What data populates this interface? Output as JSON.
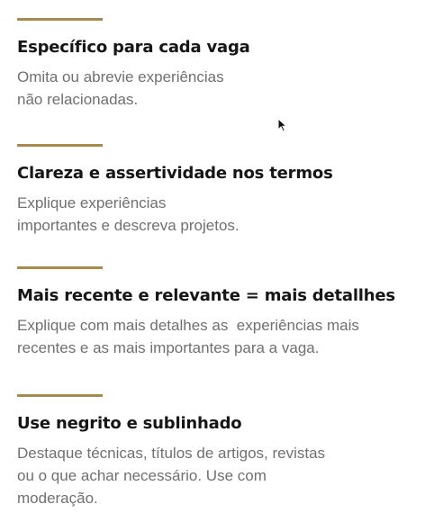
{
  "sections": [
    {
      "title": "Específico para cada vaga",
      "lines": [
        "Omita ou abrevie experiências",
        "não relacionadas."
      ]
    },
    {
      "title": "Clareza e assertividade nos termos",
      "lines": [
        "Explique experiências",
        "importantes e descreva projetos."
      ]
    },
    {
      "title": "Mais recente e relevante = mais detallhes",
      "lines": [
        "Explique com mais detalhes as  experiências mais",
        "recentes e as mais importantes para a vaga."
      ]
    },
    {
      "title": "Use negrito e sublinhado",
      "lines": [
        "Destaque técnicas, títulos de artigos, revistas",
        "ou o que achar necessário. Use com",
        "moderação."
      ]
    }
  ],
  "colors": {
    "accent_rule": "#a88b4a",
    "heading": "#161616",
    "body": "#707070",
    "background": "#ffffff"
  },
  "icons": {
    "cursor": "mouse-pointer-icon"
  }
}
